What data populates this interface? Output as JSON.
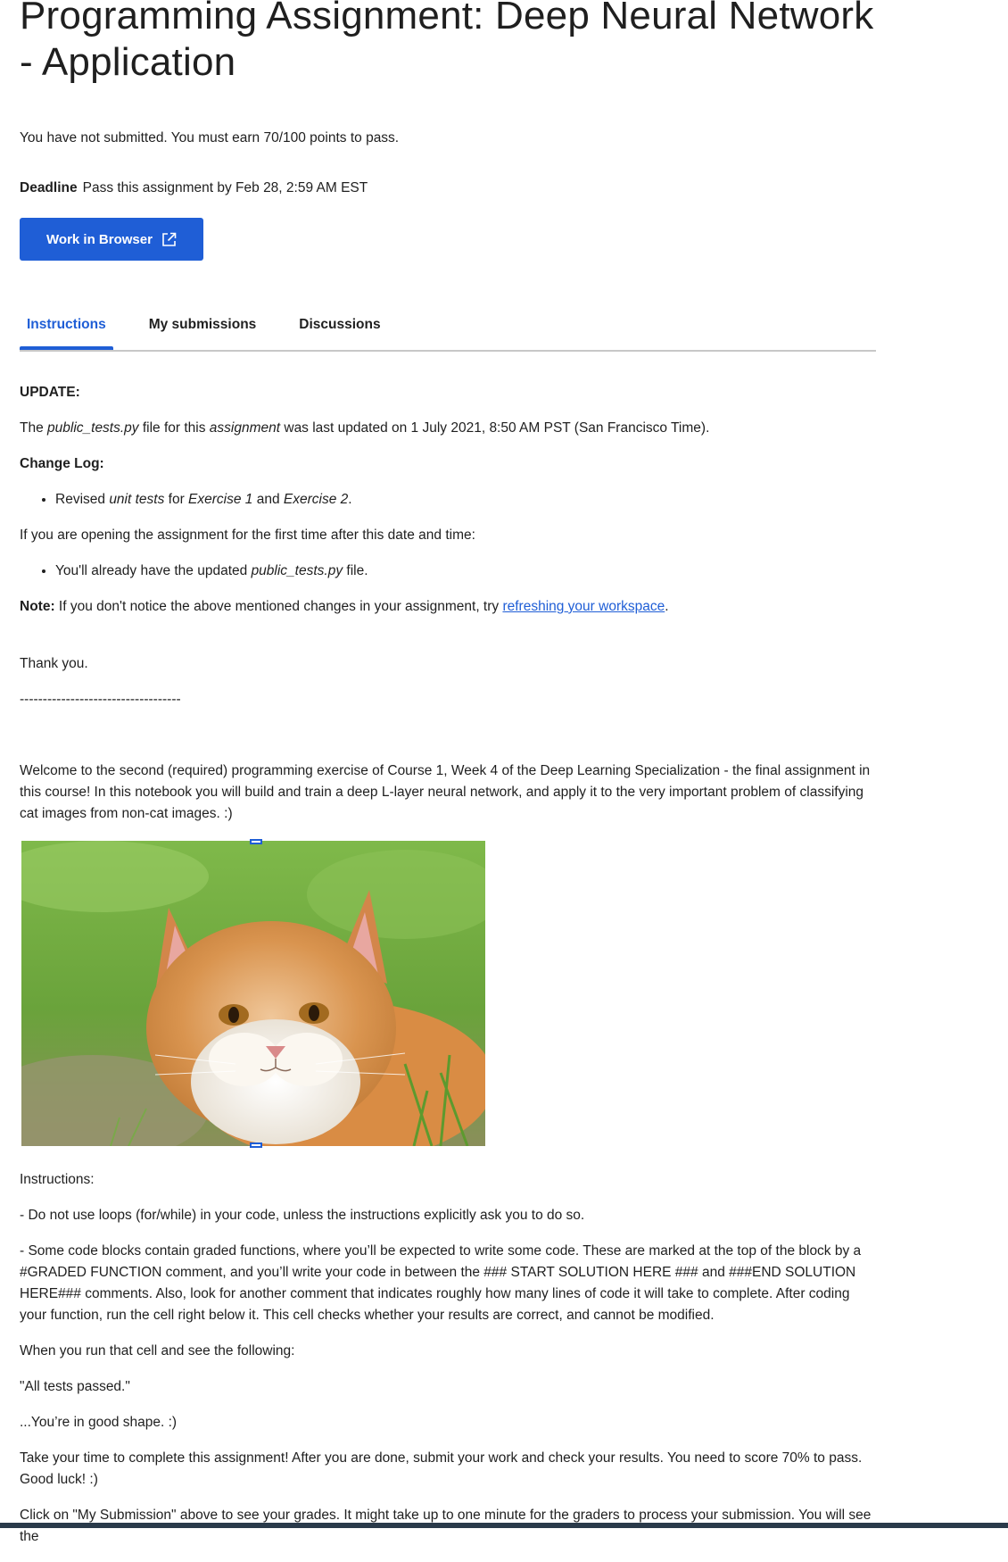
{
  "header": {
    "title": "Programming Assignment: Deep Neural Network - Application",
    "status": "You have not submitted. You must earn 70/100 points to pass.",
    "deadline_label": "Deadline",
    "deadline_text": "Pass this assignment by Feb 28, 2:59 AM EST",
    "work_button": "Work in Browser"
  },
  "tabs": [
    {
      "label": "Instructions",
      "active": true
    },
    {
      "label": "My submissions",
      "active": false
    },
    {
      "label": "Discussions",
      "active": false
    }
  ],
  "content": {
    "update_heading": "UPDATE:",
    "update_line": {
      "t1": "The ",
      "file": "public_tests.py",
      "t2": " file for this ",
      "assignment": "assignment",
      "t3": " was last updated on 1 July 2021, 8:50 AM PST (San Francisco Time)."
    },
    "changelog_heading": "Change Log:",
    "changelog_item": {
      "t1": "Revised ",
      "unit": "unit tests",
      "t2": " for ",
      "ex1": "Exercise 1",
      "t3": " and ",
      "ex2": "Exercise 2",
      "t4": "."
    },
    "first_time": "If you are opening the assignment for the first time after this date and time:",
    "already_item": {
      "t1": "You'll already have the updated ",
      "file": "public_tests.py",
      "t2": " file."
    },
    "note": {
      "label": "Note:",
      "text": " If you don't notice the above mentioned changes in your assignment, try ",
      "link": "refreshing your workspace",
      "end": "."
    },
    "thanks": "Thank you.",
    "divider": "-----------------------------------",
    "welcome": "Welcome to the second (required) programming exercise of Course 1, Week 4 of the Deep Learning Specialization - the final assignment in this course! In this notebook you will build and train a deep L-layer neural network, and apply it to the very important problem of classifying cat images from non-cat images.  :)",
    "instructions_heading": "Instructions:",
    "bullet1": "- Do not use loops (for/while) in your code, unless the instructions explicitly ask you to do so.",
    "bullet2": "- Some code blocks contain graded functions, where you’ll be expected to write some code. These are marked at the top of the block by a #GRADED FUNCTION comment, and you’ll write your code in between the ### START SOLUTION HERE ### and ###END SOLUTION HERE### comments. Also, look for another comment that indicates roughly how many lines of code it will take to complete. After coding your function, run the cell right below it. This cell checks whether your results are correct, and cannot be modified.",
    "when_run": "When you run that cell and see the following:",
    "all_passed": "\"All tests passed.\"",
    "good_shape": "...You’re in good shape. :)",
    "take_time": "Take your time to complete this assignment! After you are done, submit your work and check your results. You need to score 70% to pass. Good luck! :)",
    "click_on": "Click on \"My Submission\" above to see your grades. It might take up to one minute for the graders to process your submission. You will see the"
  },
  "icons": {
    "external_link": "external-link-icon"
  },
  "colors": {
    "accent": "#1f5ed6",
    "text": "#1f1f1f"
  }
}
